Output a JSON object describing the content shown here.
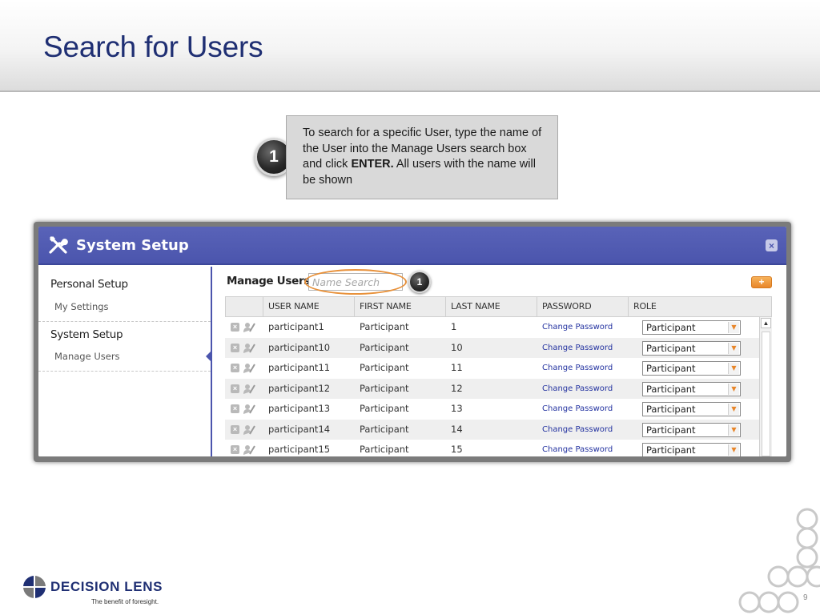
{
  "slide": {
    "title": "Search for Users",
    "page_number": "9"
  },
  "callout": {
    "number": "1",
    "text_before": "To search for a specific User, type the name of the User into the Manage Users search box and click ",
    "text_bold": "ENTER.",
    "text_after": " All users with the name will be shown"
  },
  "app": {
    "title": "System Setup",
    "close_icon": "close-icon",
    "sidebar": {
      "sections": [
        {
          "label": "Personal Setup",
          "items": [
            {
              "label": "My Settings"
            }
          ]
        },
        {
          "label": "System Setup",
          "items": [
            {
              "label": "Manage Users"
            }
          ]
        }
      ]
    },
    "main": {
      "label": "Manage Users",
      "search_placeholder": "Name Search",
      "search_value": "",
      "marker_number": "1",
      "add_button_label": "+",
      "table": {
        "columns": [
          "USER NAME",
          "FIRST NAME",
          "LAST NAME",
          "PASSWORD",
          "ROLE"
        ],
        "rows": [
          {
            "username": "participant1",
            "first_name": "Participant",
            "last_name": "1",
            "password": "Change Password",
            "role": "Participant"
          },
          {
            "username": "participant10",
            "first_name": "Participant",
            "last_name": "10",
            "password": "Change Password",
            "role": "Participant"
          },
          {
            "username": "participant11",
            "first_name": "Participant",
            "last_name": "11",
            "password": "Change Password",
            "role": "Participant"
          },
          {
            "username": "participant12",
            "first_name": "Participant",
            "last_name": "12",
            "password": "Change Password",
            "role": "Participant"
          },
          {
            "username": "participant13",
            "first_name": "Participant",
            "last_name": "13",
            "password": "Change Password",
            "role": "Participant"
          },
          {
            "username": "participant14",
            "first_name": "Participant",
            "last_name": "14",
            "password": "Change Password",
            "role": "Participant"
          },
          {
            "username": "participant15",
            "first_name": "Participant",
            "last_name": "15",
            "password": "Change Password",
            "role": "Participant"
          }
        ]
      }
    }
  },
  "footer": {
    "logo_text": "DECISION LENS",
    "tagline": "The benefit of foresight."
  },
  "colors": {
    "title_blue": "#1f2f73",
    "app_header": "#4b55ad",
    "highlight_orange": "#e8913a",
    "link_blue": "#2433a0"
  }
}
